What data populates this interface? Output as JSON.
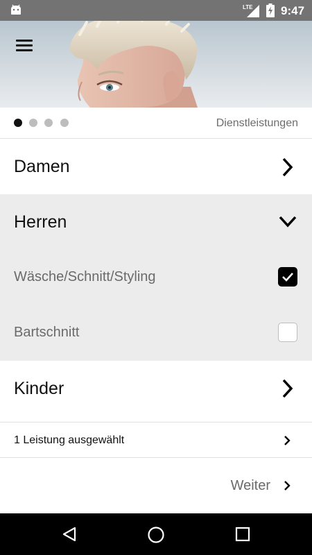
{
  "status_bar": {
    "network": "LTE",
    "time": "9:47"
  },
  "pager": {
    "pages": 4,
    "active": 0,
    "label": "Dienstleistungen"
  },
  "categories": [
    {
      "label": "Damen",
      "state": "collapsed"
    },
    {
      "label": "Herren",
      "state": "expanded",
      "services": [
        {
          "label": "Wäsche/Schnitt/Styling",
          "checked": true
        },
        {
          "label": "Bartschnitt",
          "checked": false
        }
      ]
    },
    {
      "label": "Kinder",
      "state": "collapsed"
    }
  ],
  "summary": {
    "text": "1 Leistung ausgewählt"
  },
  "footer": {
    "next_label": "Weiter"
  },
  "icons": [
    "android-icon",
    "lte-signal-icon",
    "battery-icon",
    "menu-icon",
    "chevron-right-icon",
    "chevron-down-icon",
    "check-icon",
    "back-icon",
    "home-icon",
    "recents-icon"
  ]
}
